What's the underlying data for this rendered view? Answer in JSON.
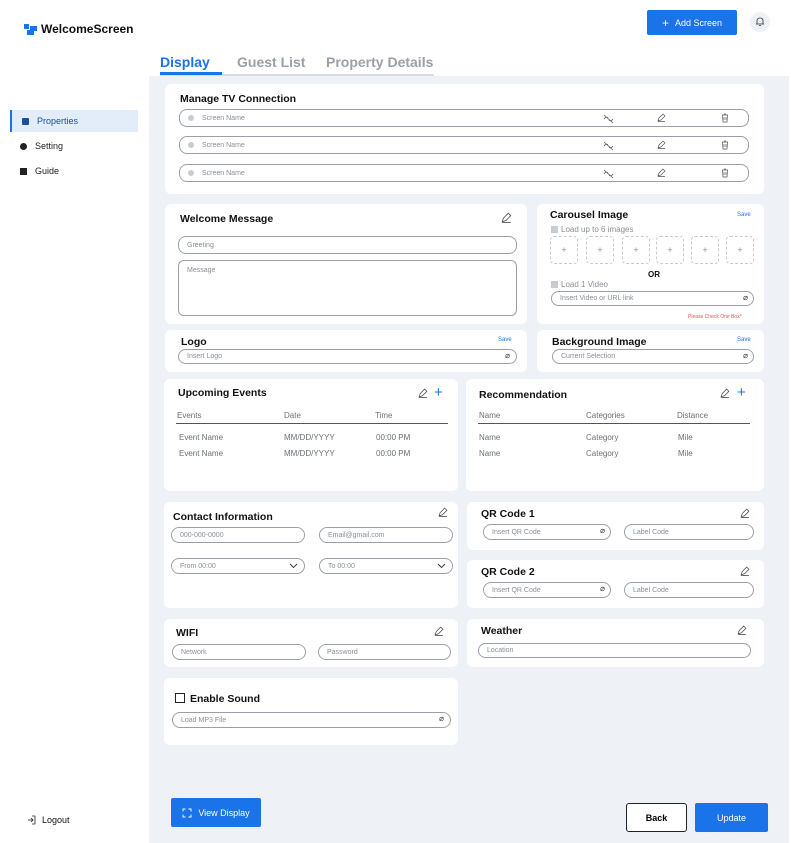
{
  "app": {
    "name": "WelcomeScreen"
  },
  "header": {
    "add_screen_label": "Add Screen"
  },
  "tabs": [
    {
      "label": "Display",
      "active": true
    },
    {
      "label": "Guest List",
      "active": false
    },
    {
      "label": "Property Details",
      "active": false
    }
  ],
  "sidebar": {
    "items": [
      {
        "label": "Properties",
        "icon": "building-icon",
        "active": true
      },
      {
        "label": "Setting",
        "icon": "gear-icon",
        "active": false
      },
      {
        "label": "Guide",
        "icon": "book-icon",
        "active": false
      }
    ],
    "logout_label": "Logout"
  },
  "tv_connection": {
    "title": "Manage TV  Connection",
    "screens": [
      {
        "placeholder": "Screen Name"
      },
      {
        "placeholder": "Screen Name"
      },
      {
        "placeholder": "Screen Name"
      }
    ]
  },
  "welcome_message": {
    "title": "Welcome Message",
    "greeting_placeholder": "Greeting",
    "message_placeholder": "Message"
  },
  "carousel": {
    "title": "Carousel Image",
    "save_label": "Save",
    "images_option": "Load up to 6 images",
    "slots": [
      "+",
      "+",
      "+",
      "+",
      "+",
      "+"
    ],
    "or_label": "OR",
    "video_option": "Load 1 Video",
    "video_placeholder": "Insert Video or URL link",
    "warning": "Please Check One Box*"
  },
  "logo": {
    "title": "Logo",
    "save_label": "Save",
    "placeholder": "Insert Logo"
  },
  "background": {
    "title": "Background Image",
    "save_label": "Save",
    "placeholder": "Current Selection"
  },
  "events": {
    "title": "Upcoming Events",
    "columns": [
      "Events",
      "Date",
      "Time"
    ],
    "rows": [
      [
        "Event Name",
        "MM/DD/YYYY",
        "00:00 PM"
      ],
      [
        "Event Name",
        "MM/DD/YYYY",
        "00:00 PM"
      ]
    ]
  },
  "recommendation": {
    "title": "Recommendation",
    "columns": [
      "Name",
      "Categories",
      "Distance"
    ],
    "rows": [
      [
        "Name",
        "Category",
        "Mile"
      ],
      [
        "Name",
        "Category",
        "Mile"
      ]
    ]
  },
  "contact": {
    "title": "Contact Information",
    "phone_placeholder": "000-000-0000",
    "email_placeholder": "Email@gmail.com",
    "from_value": "From 00:00",
    "to_value": "To 00:00"
  },
  "qr1": {
    "title": "QR Code 1",
    "code_placeholder": "Insert QR Code",
    "label_placeholder": "Label Code"
  },
  "qr2": {
    "title": "QR Code 2",
    "code_placeholder": "Insert QR Code",
    "label_placeholder": "Label Code"
  },
  "wifi": {
    "title": "WIFI",
    "network_placeholder": "Network",
    "password_placeholder": "Password"
  },
  "weather": {
    "title": "Weather",
    "location_placeholder": "Location"
  },
  "sound": {
    "label": "Enable Sound",
    "placeholder": "Load MP3 File"
  },
  "footer": {
    "view_display_label": "View Display",
    "back_label": "Back",
    "update_label": "Update"
  },
  "colors": {
    "accent": "#1a73e8",
    "background": "#eef2f7",
    "warning": "#e0584f"
  }
}
